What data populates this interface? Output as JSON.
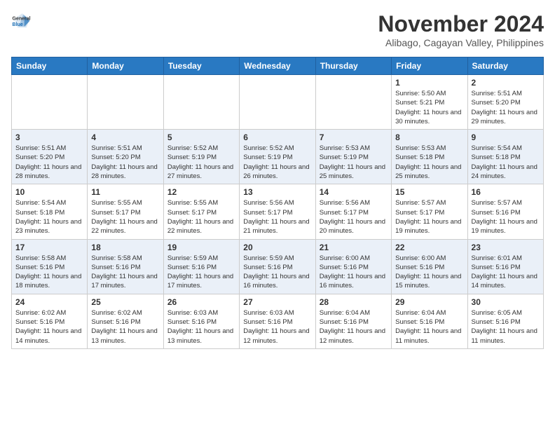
{
  "header": {
    "logo_line1": "General",
    "logo_line2": "Blue",
    "month": "November 2024",
    "location": "Alibago, Cagayan Valley, Philippines"
  },
  "weekdays": [
    "Sunday",
    "Monday",
    "Tuesday",
    "Wednesday",
    "Thursday",
    "Friday",
    "Saturday"
  ],
  "weeks": [
    [
      {
        "day": "",
        "info": ""
      },
      {
        "day": "",
        "info": ""
      },
      {
        "day": "",
        "info": ""
      },
      {
        "day": "",
        "info": ""
      },
      {
        "day": "",
        "info": ""
      },
      {
        "day": "1",
        "info": "Sunrise: 5:50 AM\nSunset: 5:21 PM\nDaylight: 11 hours and 30 minutes."
      },
      {
        "day": "2",
        "info": "Sunrise: 5:51 AM\nSunset: 5:20 PM\nDaylight: 11 hours and 29 minutes."
      }
    ],
    [
      {
        "day": "3",
        "info": "Sunrise: 5:51 AM\nSunset: 5:20 PM\nDaylight: 11 hours and 28 minutes."
      },
      {
        "day": "4",
        "info": "Sunrise: 5:51 AM\nSunset: 5:20 PM\nDaylight: 11 hours and 28 minutes."
      },
      {
        "day": "5",
        "info": "Sunrise: 5:52 AM\nSunset: 5:19 PM\nDaylight: 11 hours and 27 minutes."
      },
      {
        "day": "6",
        "info": "Sunrise: 5:52 AM\nSunset: 5:19 PM\nDaylight: 11 hours and 26 minutes."
      },
      {
        "day": "7",
        "info": "Sunrise: 5:53 AM\nSunset: 5:19 PM\nDaylight: 11 hours and 25 minutes."
      },
      {
        "day": "8",
        "info": "Sunrise: 5:53 AM\nSunset: 5:18 PM\nDaylight: 11 hours and 25 minutes."
      },
      {
        "day": "9",
        "info": "Sunrise: 5:54 AM\nSunset: 5:18 PM\nDaylight: 11 hours and 24 minutes."
      }
    ],
    [
      {
        "day": "10",
        "info": "Sunrise: 5:54 AM\nSunset: 5:18 PM\nDaylight: 11 hours and 23 minutes."
      },
      {
        "day": "11",
        "info": "Sunrise: 5:55 AM\nSunset: 5:17 PM\nDaylight: 11 hours and 22 minutes."
      },
      {
        "day": "12",
        "info": "Sunrise: 5:55 AM\nSunset: 5:17 PM\nDaylight: 11 hours and 22 minutes."
      },
      {
        "day": "13",
        "info": "Sunrise: 5:56 AM\nSunset: 5:17 PM\nDaylight: 11 hours and 21 minutes."
      },
      {
        "day": "14",
        "info": "Sunrise: 5:56 AM\nSunset: 5:17 PM\nDaylight: 11 hours and 20 minutes."
      },
      {
        "day": "15",
        "info": "Sunrise: 5:57 AM\nSunset: 5:17 PM\nDaylight: 11 hours and 19 minutes."
      },
      {
        "day": "16",
        "info": "Sunrise: 5:57 AM\nSunset: 5:16 PM\nDaylight: 11 hours and 19 minutes."
      }
    ],
    [
      {
        "day": "17",
        "info": "Sunrise: 5:58 AM\nSunset: 5:16 PM\nDaylight: 11 hours and 18 minutes."
      },
      {
        "day": "18",
        "info": "Sunrise: 5:58 AM\nSunset: 5:16 PM\nDaylight: 11 hours and 17 minutes."
      },
      {
        "day": "19",
        "info": "Sunrise: 5:59 AM\nSunset: 5:16 PM\nDaylight: 11 hours and 17 minutes."
      },
      {
        "day": "20",
        "info": "Sunrise: 5:59 AM\nSunset: 5:16 PM\nDaylight: 11 hours and 16 minutes."
      },
      {
        "day": "21",
        "info": "Sunrise: 6:00 AM\nSunset: 5:16 PM\nDaylight: 11 hours and 16 minutes."
      },
      {
        "day": "22",
        "info": "Sunrise: 6:00 AM\nSunset: 5:16 PM\nDaylight: 11 hours and 15 minutes."
      },
      {
        "day": "23",
        "info": "Sunrise: 6:01 AM\nSunset: 5:16 PM\nDaylight: 11 hours and 14 minutes."
      }
    ],
    [
      {
        "day": "24",
        "info": "Sunrise: 6:02 AM\nSunset: 5:16 PM\nDaylight: 11 hours and 14 minutes."
      },
      {
        "day": "25",
        "info": "Sunrise: 6:02 AM\nSunset: 5:16 PM\nDaylight: 11 hours and 13 minutes."
      },
      {
        "day": "26",
        "info": "Sunrise: 6:03 AM\nSunset: 5:16 PM\nDaylight: 11 hours and 13 minutes."
      },
      {
        "day": "27",
        "info": "Sunrise: 6:03 AM\nSunset: 5:16 PM\nDaylight: 11 hours and 12 minutes."
      },
      {
        "day": "28",
        "info": "Sunrise: 6:04 AM\nSunset: 5:16 PM\nDaylight: 11 hours and 12 minutes."
      },
      {
        "day": "29",
        "info": "Sunrise: 6:04 AM\nSunset: 5:16 PM\nDaylight: 11 hours and 11 minutes."
      },
      {
        "day": "30",
        "info": "Sunrise: 6:05 AM\nSunset: 5:16 PM\nDaylight: 11 hours and 11 minutes."
      }
    ]
  ]
}
